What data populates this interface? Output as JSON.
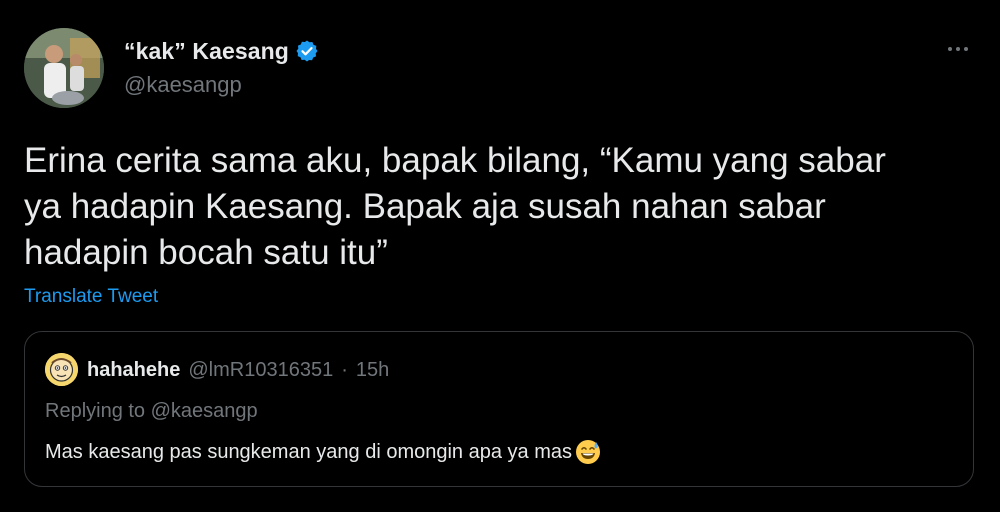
{
  "author": {
    "display_name": "“kak” Kaesang",
    "handle": "@kaesangp",
    "verified": true,
    "avatar_icon": "profile-photo"
  },
  "menu": {
    "more_icon": "ellipsis-icon"
  },
  "tweet": {
    "text": "Erina cerita sama aku, bapak bilang, “Kamu yang sabar\nya hadapin Kaesang. Bapak aja susah nahan sabar\nhadapin bocah satu itu”",
    "translate_label": "Translate Tweet"
  },
  "quoted": {
    "display_name": "hahahehe",
    "handle": "@lmR10316351",
    "separator": "·",
    "time": "15h",
    "replying_to": "Replying to @kaesangp",
    "text": "Mas kaesang pas sungkeman yang di omongin apa ya mas",
    "emoji_icon": "grinning-sweat-emoji"
  },
  "colors": {
    "background": "#000000",
    "text": "#e7e9ea",
    "muted": "#71767b",
    "accent": "#1d9bf0",
    "border": "#333639"
  }
}
